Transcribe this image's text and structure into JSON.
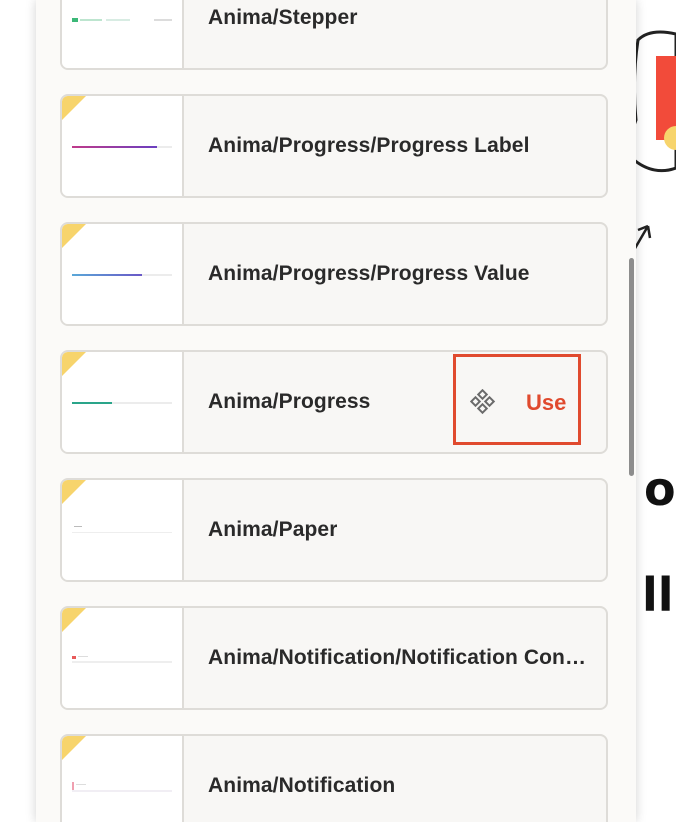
{
  "items": [
    {
      "name": "Anima/Stepper",
      "accent": "#3cb878"
    },
    {
      "name": "Anima/Progress/Progress Label",
      "accent": "#8e3fb0",
      "progress": 0.85
    },
    {
      "name": "Anima/Progress/Progress Value",
      "accent": "#6a58c7",
      "progress": 0.7
    },
    {
      "name": "Anima/Progress",
      "accent": "#2aa58a",
      "progress": 0.4
    },
    {
      "name": "Anima/Paper",
      "accent": "#c8c8c8"
    },
    {
      "name": "Anima/Notification/Notification Content",
      "accent": "#e85a5a"
    },
    {
      "name": "Anima/Notification",
      "accent": "#f0a0b0"
    }
  ],
  "hover_action": {
    "label": "Use",
    "icon": "component-icon",
    "color": "#e04a2e"
  },
  "background_text": {
    "line1": "o",
    "line2": "ll"
  }
}
